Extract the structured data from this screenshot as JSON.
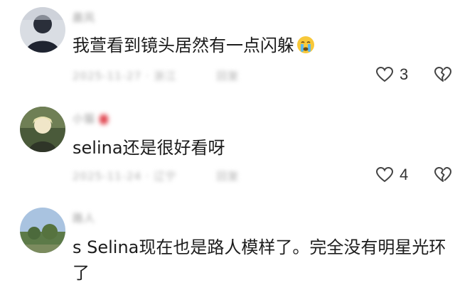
{
  "comments": [
    {
      "username": "晨风",
      "text": "我萱看到镜头居然有一点闪躲",
      "emoji": "crying-face-emoji",
      "date": "2025-11-27 · 浙江",
      "reply_label": "回复",
      "likes": "3"
    },
    {
      "username": "小猫",
      "text": "selina还是很好看呀",
      "date": "2025-11-24 · 辽宁",
      "reply_label": "回复",
      "likes": "4"
    },
    {
      "username": "路人",
      "text_line1": "s Selina现在也是路人模样了。完全没有明星光环",
      "text_line2": "了"
    }
  ],
  "colors": {
    "text": "#1c1c1c",
    "meta": "#b0b0b0",
    "icon": "#444444",
    "badge": "#e0454f"
  }
}
